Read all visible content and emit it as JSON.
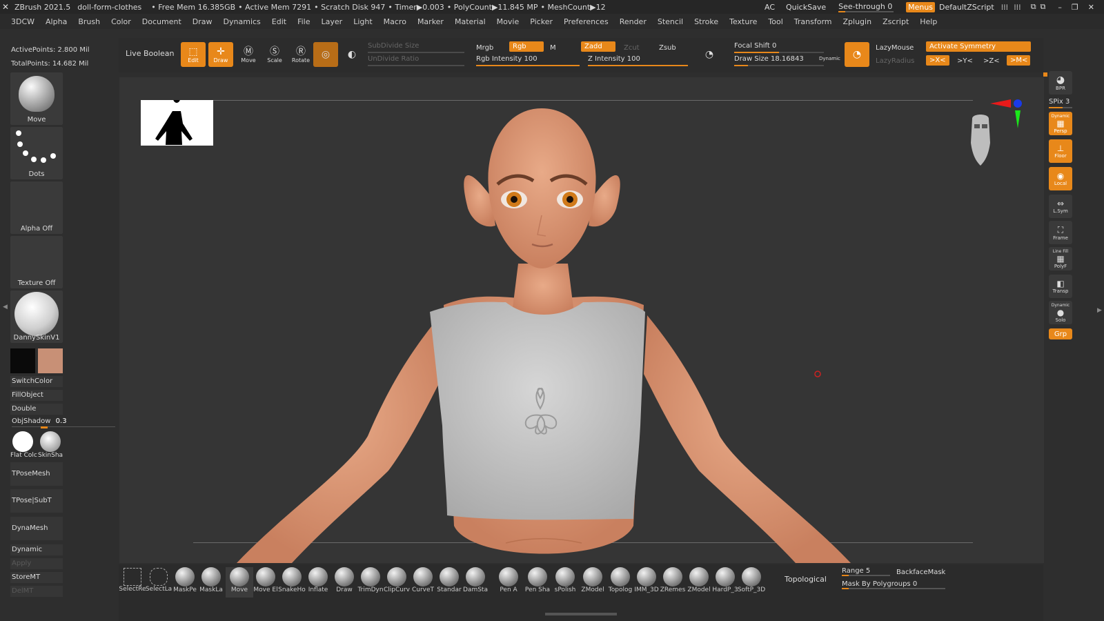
{
  "titlebar": {
    "app": "ZBrush 2021.5",
    "document": "doll-form-clothes",
    "free_mem": "• Free Mem 16.385GB",
    "active_mem": "• Active Mem 7291",
    "scratch": "• Scratch Disk 947",
    "timer": "• Timer▶0.003",
    "polycount": "• PolyCount▶11.845 MP",
    "meshcount": "• MeshCount▶12",
    "ac": "AC",
    "quicksave": "QuickSave",
    "seethrough": "See-through  0",
    "menus": "Menus",
    "script": "DefaultZScript"
  },
  "menu": [
    "3DCW",
    "Alpha",
    "Brush",
    "Color",
    "Document",
    "Draw",
    "Dynamics",
    "Edit",
    "File",
    "Layer",
    "Light",
    "Macro",
    "Marker",
    "Material",
    "Movie",
    "Picker",
    "Preferences",
    "Render",
    "Stencil",
    "Stroke",
    "Texture",
    "Tool",
    "Transform",
    "Zplugin",
    "Zscript",
    "Help"
  ],
  "stats": {
    "active_points": "ActivePoints: 2.800 Mil",
    "total_points": "TotalPoints: 14.682 Mil"
  },
  "toolbar": {
    "live_boolean": "Live Boolean",
    "edit": "Edit",
    "draw": "Draw",
    "move": "Move",
    "scale": "Scale",
    "rotate": "Rotate",
    "subdivide": "SubDivide Size",
    "undivide": "UnDivide Ratio",
    "mrgb": "Mrgb",
    "rgb": "Rgb",
    "m": "M",
    "rgb_intensity": "Rgb Intensity 100",
    "zadd": "Zadd",
    "zcut": "Zcut",
    "zsub": "Zsub",
    "z_intensity": "Z Intensity 100",
    "focal_shift": "Focal Shift 0",
    "draw_size": "Draw Size 18.16843",
    "dynamic": "Dynamic",
    "lazymouse": "LazyMouse",
    "lazyradius": "LazyRadius",
    "activate_symmetry": "Activate Symmetry",
    "sym_x": ">X<",
    "sym_y": ">Y<",
    "sym_z": ">Z<",
    "sym_m": ">M<"
  },
  "left_panel": {
    "brush": "Move",
    "stroke": "Dots",
    "alpha": "Alpha Off",
    "texture": "Texture Off",
    "material": "DannySkinV1",
    "switchcolor": "SwitchColor",
    "fillobject": "FillObject",
    "double": "Double",
    "objshadow": "ObjShadow",
    "objshadow_value": "0.3",
    "flatcolor": "Flat Colc",
    "skinshade": "SkinSha",
    "tposemesh": "TPoseMesh",
    "tpose_subt": "TPose|SubT",
    "dynamesh": "DynaMesh",
    "dynamic": "Dynamic",
    "apply": "Apply",
    "storemt": "StoreMT",
    "delmt": "DelMT",
    "primary_color": "#0a0a0a",
    "secondary_color": "#c89076"
  },
  "right_shelf": [
    "BPR",
    "SPix 3",
    "Persp",
    "Floor",
    "Local",
    "L.Sym",
    "Frame",
    "PolyF",
    "Transp",
    "Solo",
    "Grp"
  ],
  "right_shelf_labels": {
    "dynamic": "Dynamic",
    "linefill": "Line Fill"
  },
  "bottom_brushes": [
    "SelectRe",
    "SelectLa",
    "MaskPe",
    "MaskLa",
    "Move",
    "Move El",
    "SnakeHo",
    "Inflate",
    "Draw",
    "TrimDyn",
    "ClipCurv",
    "CurveT",
    "Standar",
    "DamSta",
    "Pen A",
    "Pen Sha",
    "sPolish",
    "ZModel",
    "Topolog",
    "IMM_3D",
    "ZRemes",
    "ZModel",
    "HardP_3",
    "SoftP_3D"
  ],
  "bottom_right": {
    "topological": "Topological",
    "range": "Range 5",
    "backfacemask": "BackfaceMask",
    "mask_polygroups": "Mask By Polygroups 0"
  },
  "colors": {
    "accent": "#e8881a",
    "canvas": "#353535",
    "skin": "#d99b7a",
    "shirt": "#c8c8c8"
  }
}
